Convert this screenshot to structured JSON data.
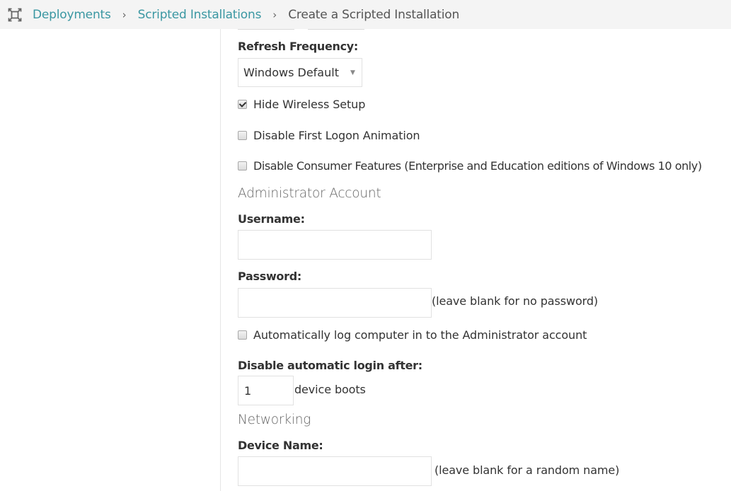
{
  "breadcrumb": {
    "icon": "fullscreen-frame-icon",
    "items": [
      {
        "label": "Deployments",
        "link": true
      },
      {
        "label": "Scripted Installations",
        "link": true
      },
      {
        "label": "Create a Scripted Installation",
        "link": false
      }
    ],
    "separator": "›"
  },
  "form": {
    "refresh_frequency": {
      "label": "Refresh Frequency:",
      "selected": "Windows Default",
      "arrow": "▼"
    },
    "checkboxes": [
      {
        "label": "Hide Wireless Setup",
        "checked": true
      },
      {
        "label": "Disable First Logon Animation",
        "checked": false
      },
      {
        "label": "Disable Consumer Features (Enterprise and Education editions of Windows 10 only)",
        "checked": false
      }
    ],
    "administrator": {
      "heading": "Administrator Account",
      "username_label": "Username:",
      "username_value": "",
      "password_label": "Password:",
      "password_value": "",
      "password_hint": "(leave blank for no password)",
      "autologin_label": "Automatically log computer in to the Administrator account",
      "autologin_checked": false,
      "disable_after_label": "Disable automatic login after:",
      "disable_after_value": "1",
      "disable_after_suffix": "device boots"
    },
    "networking": {
      "heading": "Networking",
      "device_name_label": "Device Name:",
      "device_name_value": "",
      "device_name_hint": "(leave blank for a random name)"
    }
  },
  "colors": {
    "link": "#3a97a2",
    "topbar_bg": "#f4f4f4"
  }
}
